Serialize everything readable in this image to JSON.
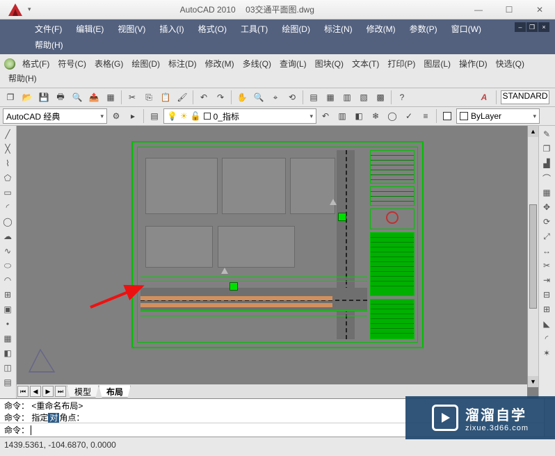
{
  "title": {
    "app": "AutoCAD 2010",
    "file": "03交通平面图.dwg"
  },
  "menu1": [
    "文件(F)",
    "编辑(E)",
    "视图(V)",
    "插入(I)",
    "格式(O)",
    "工具(T)",
    "绘图(D)",
    "标注(N)",
    "修改(M)",
    "参数(P)",
    "窗口(W)",
    "帮助(H)"
  ],
  "menu2": [
    "格式(F)",
    "符号(C)",
    "表格(G)",
    "绘图(D)",
    "标注(D)",
    "修改(M)",
    "多线(Q)",
    "查询(L)",
    "图块(Q)",
    "文本(T)",
    "打印(P)",
    "图层(L)",
    "操作(D)",
    "快选(Q)",
    "帮助(H)"
  ],
  "style_name": "STANDARD",
  "workspace": "AutoCAD 经典",
  "layer": {
    "name": "0_指标"
  },
  "bylayer": "ByLayer",
  "tabs": {
    "model": "模型",
    "layout": "布局"
  },
  "cmd": {
    "h1": "命令：  <重命名布局>",
    "h2_a": "命令：  指定",
    "h2_b": "角点：",
    "prompt": "命令："
  },
  "coords": "1439.5361, -104.6870, 0.0000",
  "watermark": {
    "line1": "溜溜自学",
    "line2": "zixue.3d66.com"
  }
}
